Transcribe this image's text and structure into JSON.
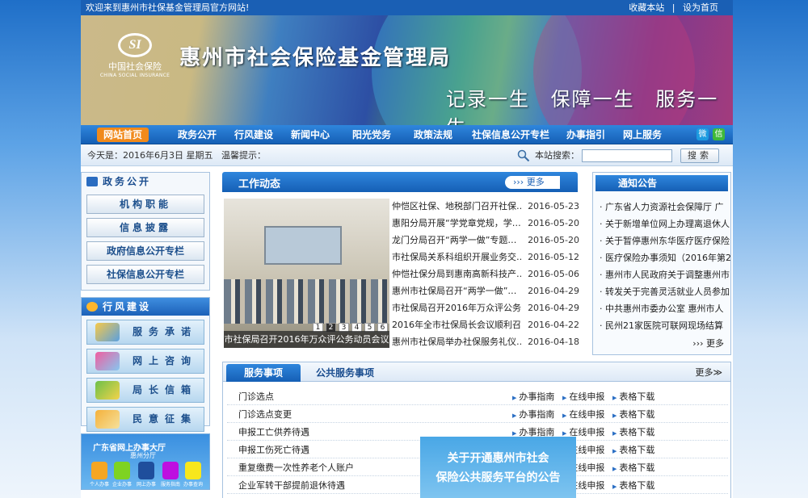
{
  "topbar": {
    "welcome": "欢迎来到惠州市社保基金管理局官方网站!",
    "bookmark": "收藏本站",
    "separator": "|",
    "set_home": "设为首页"
  },
  "banner": {
    "logo_mark": "SI",
    "logo_cn": "中国社会保险",
    "logo_en": "CHINA SOCIAL INSURANCE",
    "title": "惠州市社会保险基金管理局",
    "slogan": "记录一生  保障一生  服务一生"
  },
  "nav": {
    "items": [
      "网站首页",
      "政务公开",
      "行风建设",
      "新闻中心",
      "阳光党务",
      "政策法规",
      "社保信息公开专栏",
      "办事指引",
      "网上服务"
    ],
    "icons": [
      "weibo-icon",
      "wechat-icon"
    ]
  },
  "infobar": {
    "date": "今天是：2016年6月3日 星期五",
    "tip": "温馨提示：",
    "search_label": "本站搜索：",
    "search_value": "",
    "search_button": "搜索"
  },
  "left": {
    "gov": {
      "title": "政务公开",
      "buttons": [
        "机构职能",
        "信息披露",
        "政府信息公开专栏",
        "社保信息公开专栏"
      ]
    },
    "style": {
      "title": "行风建设",
      "buttons": [
        "服务承诺",
        "网上咨询",
        "局长信箱",
        "民意征集"
      ]
    },
    "hall": {
      "title": "广东省网上办事大厅",
      "subtitle": "惠州分厅",
      "labels": [
        "个人办事",
        "企业办事",
        "网上办事",
        "服务指南",
        "办事查询"
      ]
    }
  },
  "news": {
    "title": "工作动态",
    "more": "更多",
    "caption": "市社保局召开2016年万众评公务动员会议",
    "pages": [
      "1",
      "2",
      "3",
      "4",
      "5",
      "6"
    ],
    "items": [
      {
        "t": "仲恺区社保、地税部门召开社保…",
        "d": "2016-05-23"
      },
      {
        "t": "惠阳分局开展“学党章党规，学…",
        "d": "2016-05-20"
      },
      {
        "t": "龙门分局召开“两学一做”专题…",
        "d": "2016-05-20"
      },
      {
        "t": "市社保局关系科组织开展业务交…",
        "d": "2016-05-12"
      },
      {
        "t": "仲恺社保分局到惠南高新科技产…",
        "d": "2016-05-06"
      },
      {
        "t": "惠州市社保局召开“两学一做”…",
        "d": "2016-04-29"
      },
      {
        "t": "市社保局召开2016年万众评公务…",
        "d": "2016-04-29"
      },
      {
        "t": "2016年全市社保局长会议顺利召…",
        "d": "2016-04-22"
      },
      {
        "t": "惠州市社保局举办社保服务礼仪…",
        "d": "2016-04-18"
      }
    ]
  },
  "notice": {
    "title": "通知公告",
    "more": "更多",
    "items": [
      "广东省人力资源社会保障厅 广",
      "关于新增单位网上办理离退休人…",
      "关于暂停惠州东华医疗医疗保险…",
      "医疗保险办事须知（2016年第2",
      "惠州市人民政府关于调整惠州市…",
      "转发关于完善灵活就业人员参加…",
      "中共惠州市委办公室 惠州市人",
      "民州21家医院可联网现场结算"
    ]
  },
  "services": {
    "tab_active": "服务事项",
    "tab_other": "公共服务事项",
    "more": "更多",
    "actions": [
      "办事指南",
      "在线申报",
      "表格下载"
    ],
    "items": [
      "门诊选点",
      "门诊选点变更",
      "申报工亡供养待遇",
      "申报工伤死亡待遇",
      "重复缴费一次性养老个人账户",
      "企业军转干部提前退休待遇"
    ]
  },
  "popup": {
    "line1": "关于开通惠州市社会",
    "line2": "保险公共服务平台的公告"
  }
}
